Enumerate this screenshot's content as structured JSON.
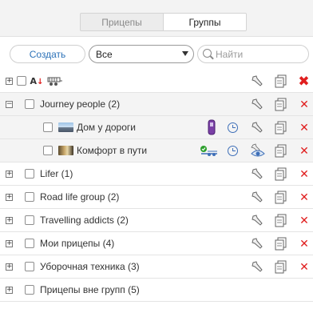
{
  "tabs": [
    {
      "label": "Прицепы",
      "active": false
    },
    {
      "label": "Группы",
      "active": true
    }
  ],
  "toolbar": {
    "create_label": "Создать",
    "filter_value": "Все",
    "search_placeholder": "Найти"
  },
  "icons": {
    "sort": "sort-az-icon",
    "filter": "trailer-filter-icon",
    "settings": "wrench-icon",
    "copy": "copy-icon",
    "delete": "delete-icon",
    "schedule": "clock-icon",
    "fuel_card": "purple-card-icon",
    "hidden": "eye-icon",
    "connected": "connected-trailer-icon",
    "trailer_thumb": "trailer-photo-icon"
  },
  "colors": {
    "accent_blue": "#2c72b8",
    "delete_red": "#e01e1e",
    "row_alt": "#f4f4f4"
  },
  "groups": [
    {
      "label": "Journey people (2)",
      "expanded": true
    },
    {
      "label": "Lifer (1)",
      "expanded": false
    },
    {
      "label": "Road life group (2)",
      "expanded": false
    },
    {
      "label": "Travelling addicts (2)",
      "expanded": false
    },
    {
      "label": "Мои прицепы (4)",
      "expanded": false
    },
    {
      "label": "Уборочная техника (3)",
      "expanded": false
    },
    {
      "label": "Прицепы вне групп (5)",
      "expanded": false
    }
  ],
  "units": [
    {
      "label": "Дом у дороги"
    },
    {
      "label": "Комфорт в пути"
    }
  ]
}
